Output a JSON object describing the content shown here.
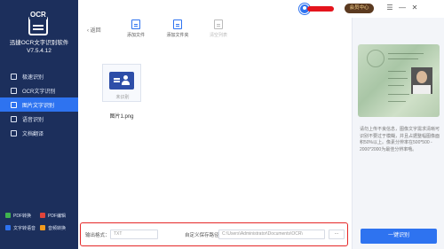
{
  "app": {
    "logo_text": "OCR",
    "name": "迅捷OCR文字识别软件",
    "version": "V7.5.4.12"
  },
  "sidebar": {
    "items": [
      {
        "label": "极速识别"
      },
      {
        "label": "OCR文字识别"
      },
      {
        "label": "图片文字识别"
      },
      {
        "label": "语音识别"
      },
      {
        "label": "文档翻译"
      }
    ],
    "tools": [
      {
        "label": "PDF转换",
        "color": "#3fb34f"
      },
      {
        "label": "PDF编辑",
        "color": "#e0443a"
      },
      {
        "label": "文字转语音",
        "color": "#2e73f0"
      },
      {
        "label": "音频转换",
        "color": "#f29a1d"
      }
    ]
  },
  "topbar": {
    "vip_label": "会员中心",
    "menu_icon": "☰",
    "minimize_icon": "—",
    "close_icon": "✕"
  },
  "toolbar": {
    "back_label": "返回",
    "add_file": "添加文件",
    "add_folder": "添加文件夹",
    "clear_list": "清空列表"
  },
  "file": {
    "status": "未识别",
    "name": "图片1.png"
  },
  "preview": {
    "tip": "请勿上传不良信息，图像文字需求清晰可识别不要过于模糊，并且占据整幅图像面积50%以上。像素分辨率在500*500 - 2000*2000为最佳分辨率哦。",
    "ocr_button": "一键识别"
  },
  "bottom": {
    "format_label": "输出格式：",
    "format_value": "TXT",
    "path_label": "自定义保存路径：",
    "path_value": "C:\\Users\\Administrator\\Documents\\OCR\\",
    "browse_label": "..."
  },
  "colors": {
    "sidebar_bg": "#1c2f5c",
    "accent": "#2e73f0",
    "highlight_border": "#e52727"
  }
}
